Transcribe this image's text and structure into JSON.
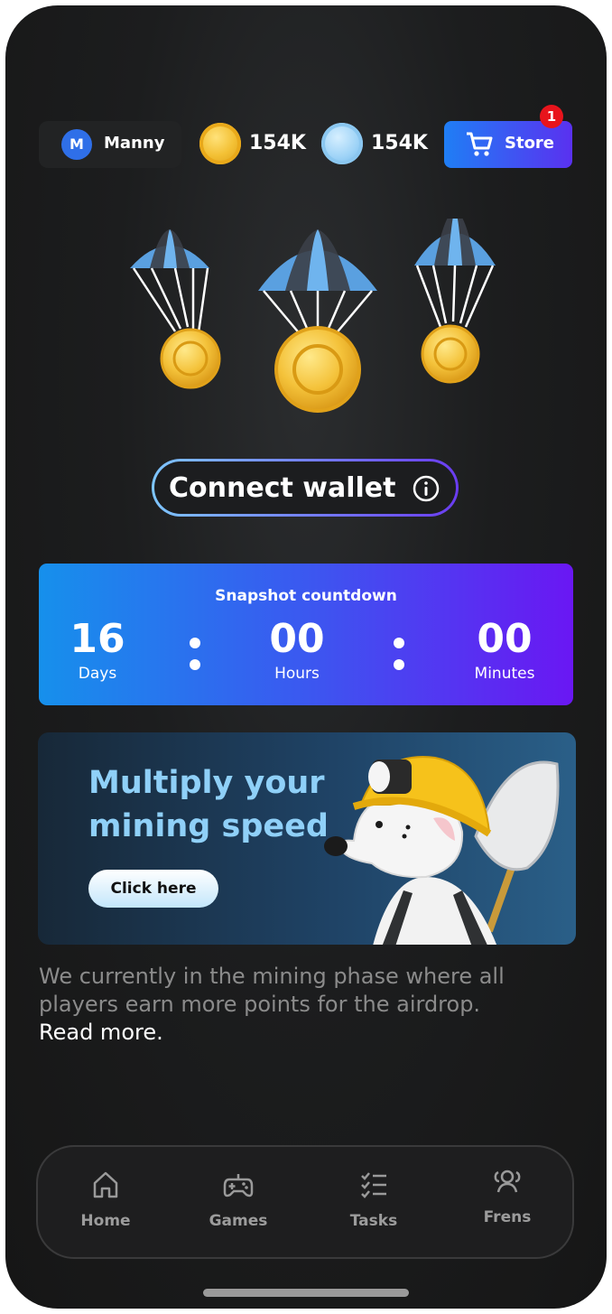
{
  "header": {
    "user": {
      "initial": "M",
      "name": "Manny"
    },
    "balances": [
      {
        "icon": "gold-coin-icon",
        "value": "154K"
      },
      {
        "icon": "blue-coin-icon",
        "value": "154K"
      }
    ],
    "store": {
      "label": "Store",
      "badge": "1",
      "icon": "cart-icon"
    }
  },
  "hero": {
    "icon": "parachute-coins-icon"
  },
  "wallet": {
    "label": "Connect wallet",
    "icon": "info-icon"
  },
  "countdown": {
    "title": "Snapshot countdown",
    "days": "16",
    "days_label": "Days",
    "hours": "00",
    "hours_label": "Hours",
    "minutes": "00",
    "minutes_label": "Minutes"
  },
  "promo": {
    "title": "Multiply your mining speed",
    "button": "Click here",
    "icon": "miner-dog-icon"
  },
  "description": {
    "text": "We currently in the mining phase where all players earn more points for the airdrop.",
    "link": "Read more."
  },
  "nav": [
    {
      "label": "Home",
      "icon": "home-icon"
    },
    {
      "label": "Games",
      "icon": "gamepad-icon"
    },
    {
      "label": "Tasks",
      "icon": "tasks-icon"
    },
    {
      "label": "Frens",
      "icon": "friends-icon"
    }
  ],
  "colors": {
    "accent_start": "#1f7ef5",
    "accent_end": "#6a17f3",
    "badge": "#e8141c",
    "background": "#161616"
  }
}
